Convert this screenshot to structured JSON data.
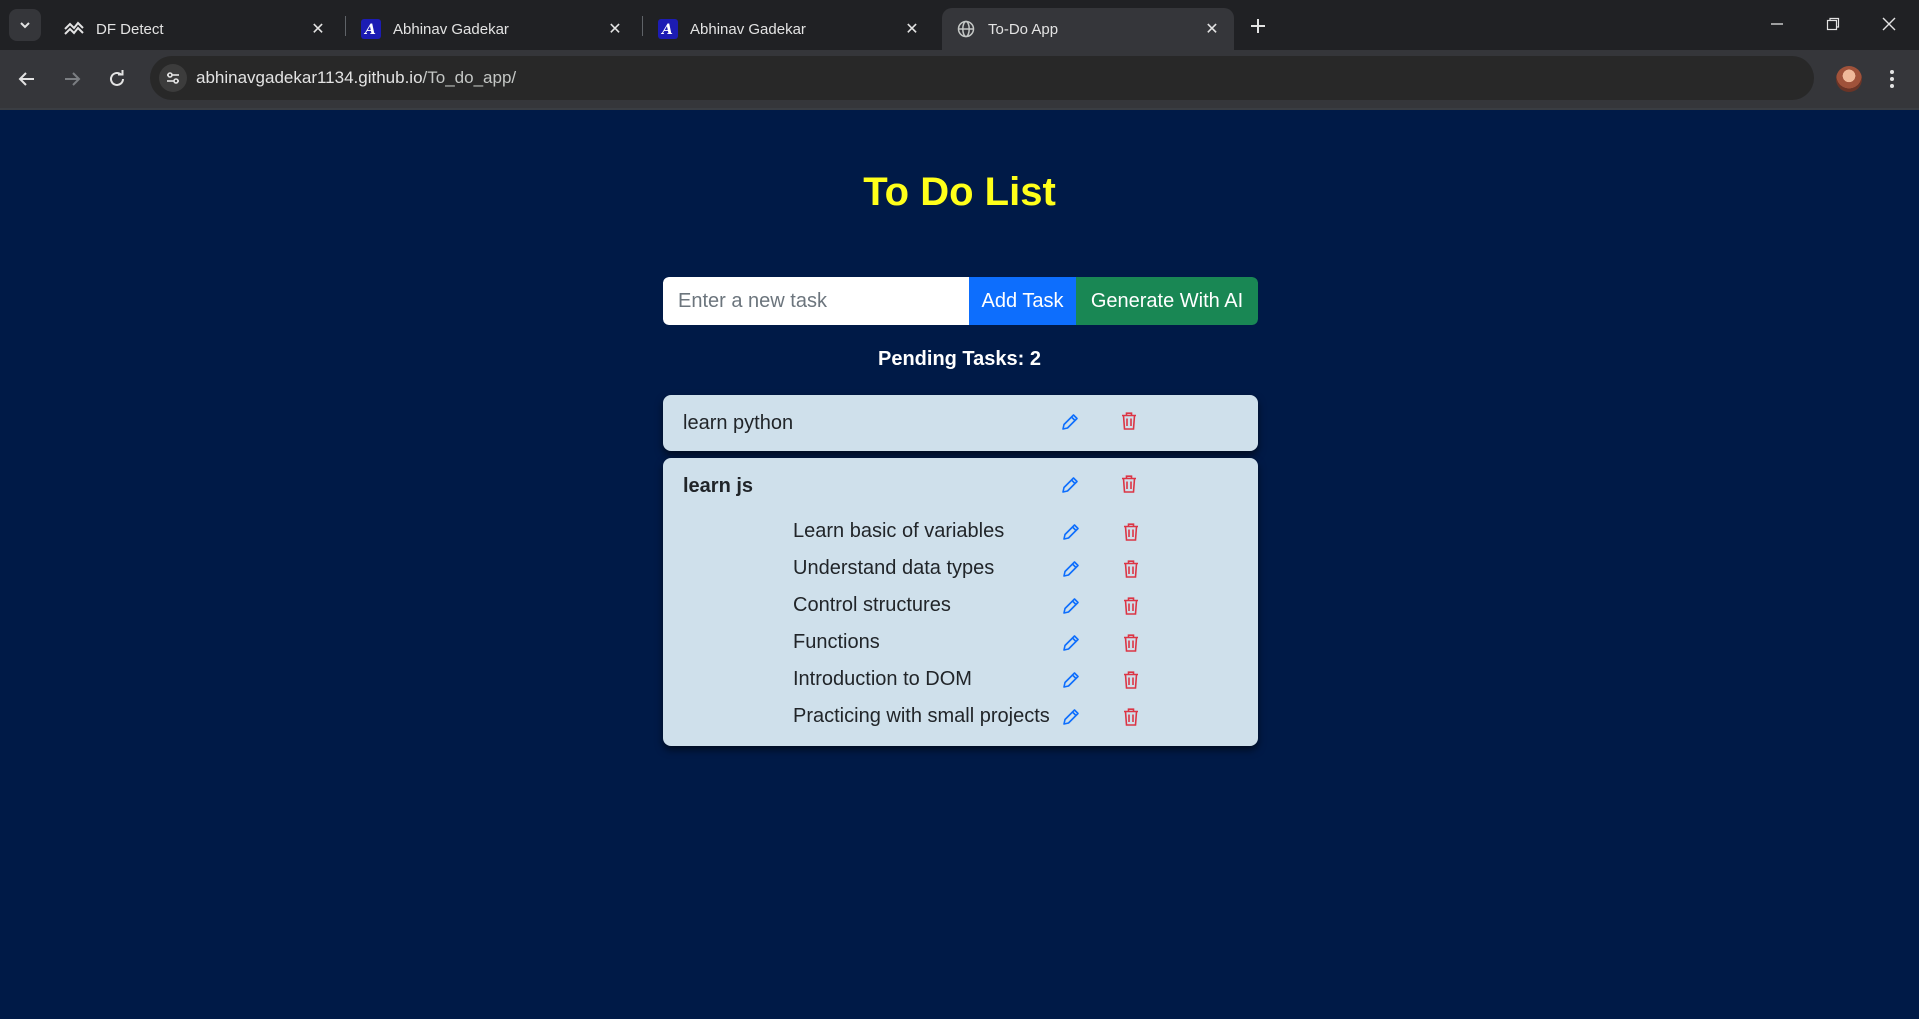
{
  "browser": {
    "tabs": [
      {
        "title": "DF Detect",
        "active": false
      },
      {
        "title": "Abhinav Gadekar",
        "active": false
      },
      {
        "title": "Abhinav Gadekar",
        "active": false
      },
      {
        "title": "To-Do App",
        "active": true
      }
    ],
    "url_host": "abhinavgadekar1134.github.io",
    "url_path": "/To_do_app/"
  },
  "app": {
    "title": "To Do List",
    "input_placeholder": "Enter a new task",
    "input_value": "",
    "add_label": "Add Task",
    "ai_label": "Generate With AI",
    "pending_text": "Pending Tasks: 2"
  },
  "tasks": [
    {
      "text": "learn python",
      "subtasks": []
    },
    {
      "text": "learn js",
      "subtasks": [
        {
          "text": "Learn basic of variables"
        },
        {
          "text": "Understand data types"
        },
        {
          "text": "Control structures"
        },
        {
          "text": "Functions"
        },
        {
          "text": "Introduction to DOM"
        },
        {
          "text": "Practicing with small projects"
        }
      ]
    }
  ],
  "colors": {
    "page_bg": "#001a47",
    "title": "#ffff1a",
    "add_button": "#0d6efd",
    "ai_button": "#198754",
    "card_bg": "#cfe0eb",
    "edit_icon": "#0d6efd",
    "delete_icon": "#dc3545"
  },
  "icons": {
    "edit": "pencil-icon",
    "delete": "trash-icon"
  }
}
